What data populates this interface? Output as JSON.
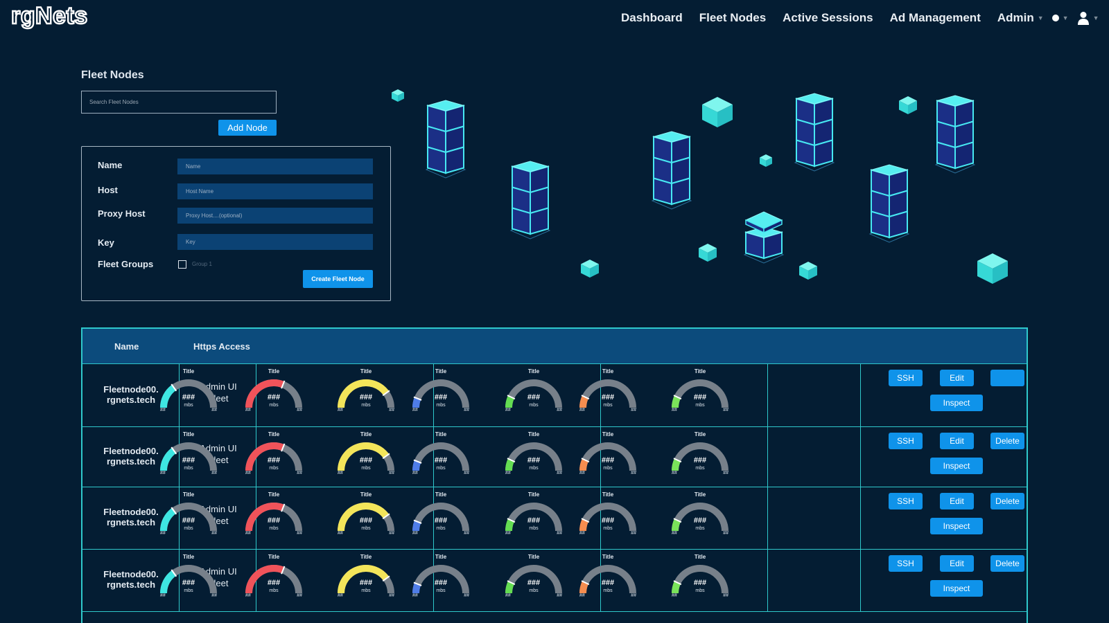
{
  "brand": {
    "name": "rgNets"
  },
  "nav": {
    "items": [
      "Dashboard",
      "Fleet Nodes",
      "Active Sessions",
      "Ad Management"
    ],
    "admin_label": "Admin"
  },
  "page": {
    "title": "Fleet Nodes",
    "search_placeholder": "Search Fleet Nodes",
    "add_node_label": "Add Node"
  },
  "form": {
    "fields": [
      {
        "label": "Name",
        "placeholder": "Name"
      },
      {
        "label": "Host",
        "placeholder": "Host Name"
      },
      {
        "label": "Proxy Host",
        "placeholder": "Proxy Host....(optional)"
      },
      {
        "label": "Key",
        "placeholder": "Key"
      }
    ],
    "groups_label": "Fleet Groups",
    "group_option": "Group 1",
    "group_checked": false,
    "submit_label": "Create Fleet Node"
  },
  "table": {
    "columns": [
      "Name",
      "Https Access"
    ],
    "actions": {
      "ssh": "SSH",
      "edit": "Edit",
      "delete": "Delete",
      "inspect": "Inspect"
    },
    "gauge_colors": [
      "#3ee6e2",
      "#f0535a",
      "#f3e55a",
      "#4f7de8",
      "#64dd52",
      "#f58d4f",
      "#7ae35a"
    ],
    "gauge_levels": [
      0.3,
      0.62,
      0.8,
      0.12,
      0.14,
      0.14,
      0.14
    ],
    "gauge": {
      "title": "Title",
      "value": "###",
      "unit": "mbs",
      "min": "##",
      "max": "##"
    },
    "rows": [
      {
        "name": "Fleetnode00.\nrgnets.tech",
        "access": "Admin UI\nFleet",
        "delete_label": ""
      },
      {
        "name": "Fleetnode00.\nrgnets.tech",
        "access": "Admin UI\nFleet",
        "delete_label": "Delete"
      },
      {
        "name": "Fleetnode00.\nrgnets.tech",
        "access": "Admin UI\nFleet",
        "delete_label": "Delete"
      },
      {
        "name": "Fleetnode00.\nrgnets.tech",
        "access": "Admin UI\nFleet",
        "delete_label": "Delete"
      }
    ]
  },
  "colors": {
    "background": "#041d33",
    "accent": "#0f93ea",
    "table_border": "#2fc9cc",
    "header": "#0c4b7c",
    "input": "#0b4274"
  }
}
